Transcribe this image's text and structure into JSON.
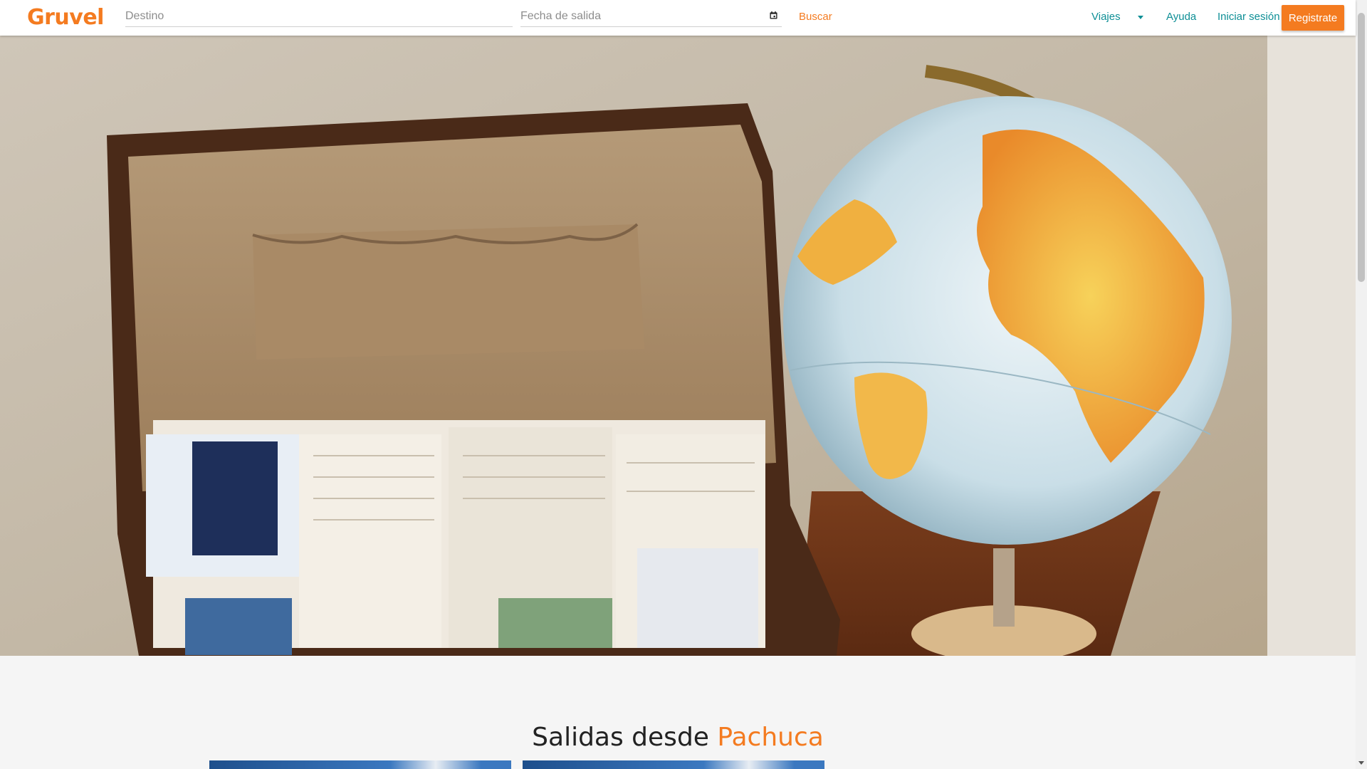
{
  "brand": {
    "logo_text": "Gruvel"
  },
  "search": {
    "destination_placeholder": "Destino",
    "date_placeholder": "Fecha de salida",
    "search_label": "Buscar"
  },
  "nav": {
    "trips_label": "Viajes",
    "help_label": "Ayuda",
    "login_label": "Iniciar sesión",
    "register_label": "Registrate"
  },
  "hero": {
    "image_description_icon": "suitcase-and-globe-photo"
  },
  "departures": {
    "title_prefix": "Salidas desde",
    "city": "Pachuca"
  },
  "colors": {
    "brand_orange": "#f47b20",
    "nav_teal": "#0e8f96"
  }
}
